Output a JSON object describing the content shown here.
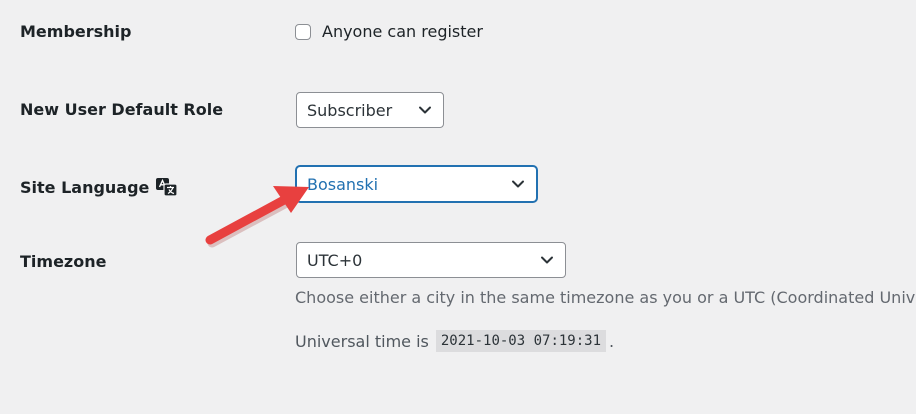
{
  "membership": {
    "label": "Membership",
    "checkbox_label": "Anyone can register",
    "checked": false
  },
  "default_role": {
    "label": "New User Default Role",
    "selected": "Subscriber"
  },
  "site_language": {
    "label": "Site Language",
    "selected": "Bosanski"
  },
  "timezone": {
    "label": "Timezone",
    "selected": "UTC+0",
    "description": "Choose either a city in the same timezone as you or a UTC (Coordinated Universal Time) time offset.",
    "universal_prefix": "Universal time is",
    "universal_time": "2021-10-03 07:19:31",
    "universal_suffix": "."
  },
  "colors": {
    "background": "#f0f0f1",
    "focus_blue": "#2271b1",
    "annotation_arrow": "#e8403f"
  },
  "icons": {
    "language": "translation-icon",
    "select": "chevron-down-icon"
  }
}
